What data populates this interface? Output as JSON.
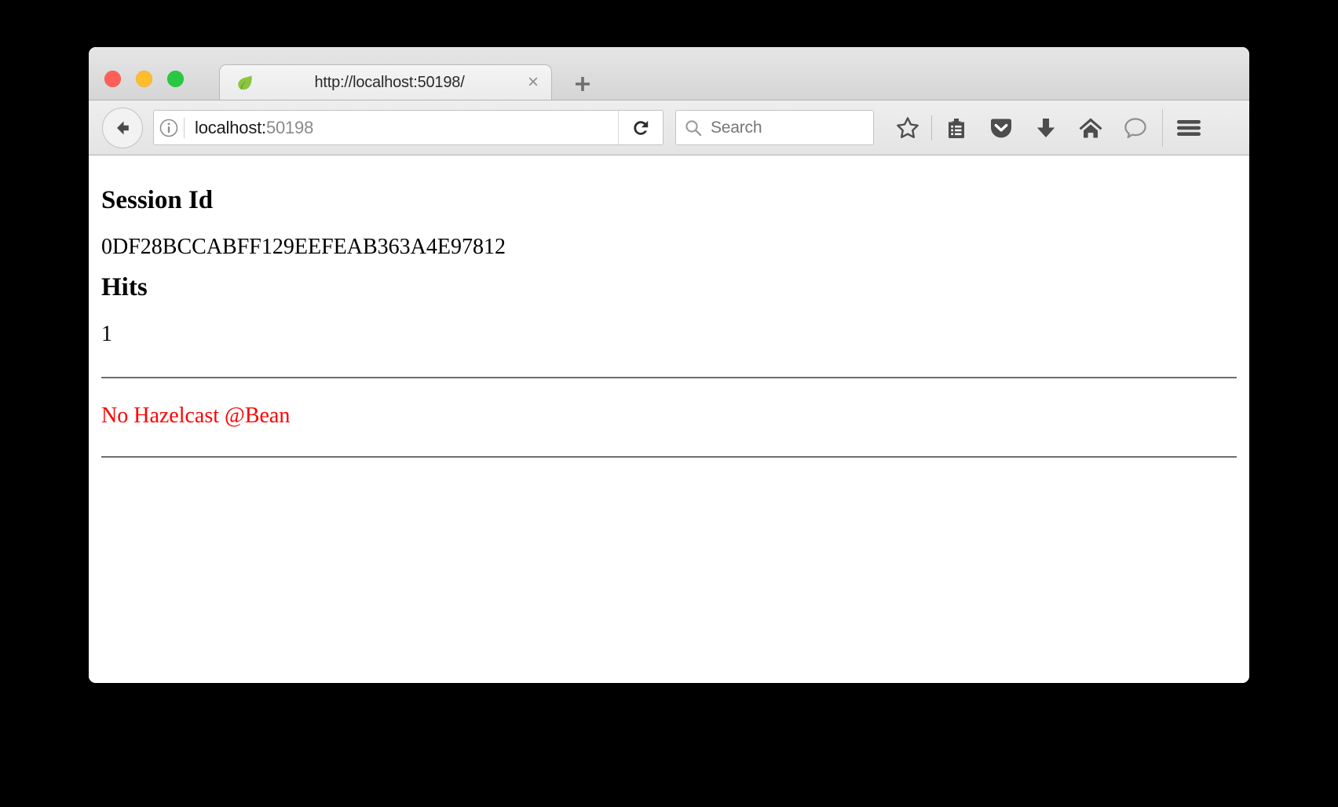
{
  "window": {
    "traffic_lights": [
      {
        "name": "close",
        "color": "#ff5f57"
      },
      {
        "name": "minimize",
        "color": "#ffbd2e"
      },
      {
        "name": "zoom",
        "color": "#28c940"
      }
    ]
  },
  "tab_strip": {
    "tabs": [
      {
        "title": "http://localhost:50198/",
        "favicon": "spring-leaf-icon",
        "close_label": "×",
        "active": true
      }
    ],
    "new_tab_label": "+"
  },
  "toolbar": {
    "back_icon": "back-arrow-icon",
    "identity_icon": "info-circle-icon",
    "url_prefix": "localhost:",
    "url_port": "50198",
    "url_full": "localhost:50198",
    "reload_icon": "reload-icon",
    "search": {
      "icon": "search-icon",
      "placeholder": "Search",
      "value": ""
    },
    "icons": [
      {
        "name": "bookmark-star-icon",
        "label": "Bookmark this page"
      },
      {
        "name": "reading-list-icon",
        "label": "Show your bookmarks"
      },
      {
        "name": "pocket-icon",
        "label": "Save to Pocket"
      },
      {
        "name": "downloads-icon",
        "label": "Downloads"
      },
      {
        "name": "home-icon",
        "label": "Home"
      },
      {
        "name": "sync-chat-icon",
        "label": "Synced tabs"
      },
      {
        "name": "hamburger-menu-icon",
        "label": "Open menu"
      }
    ]
  },
  "page": {
    "session_heading": "Session Id",
    "session_id": "0DF28BCCABFF129EEFEAB363A4E97812",
    "hits_heading": "Hits",
    "hits_value": "1",
    "error_message": "No Hazelcast @Bean",
    "error_color": "#ff0000"
  }
}
